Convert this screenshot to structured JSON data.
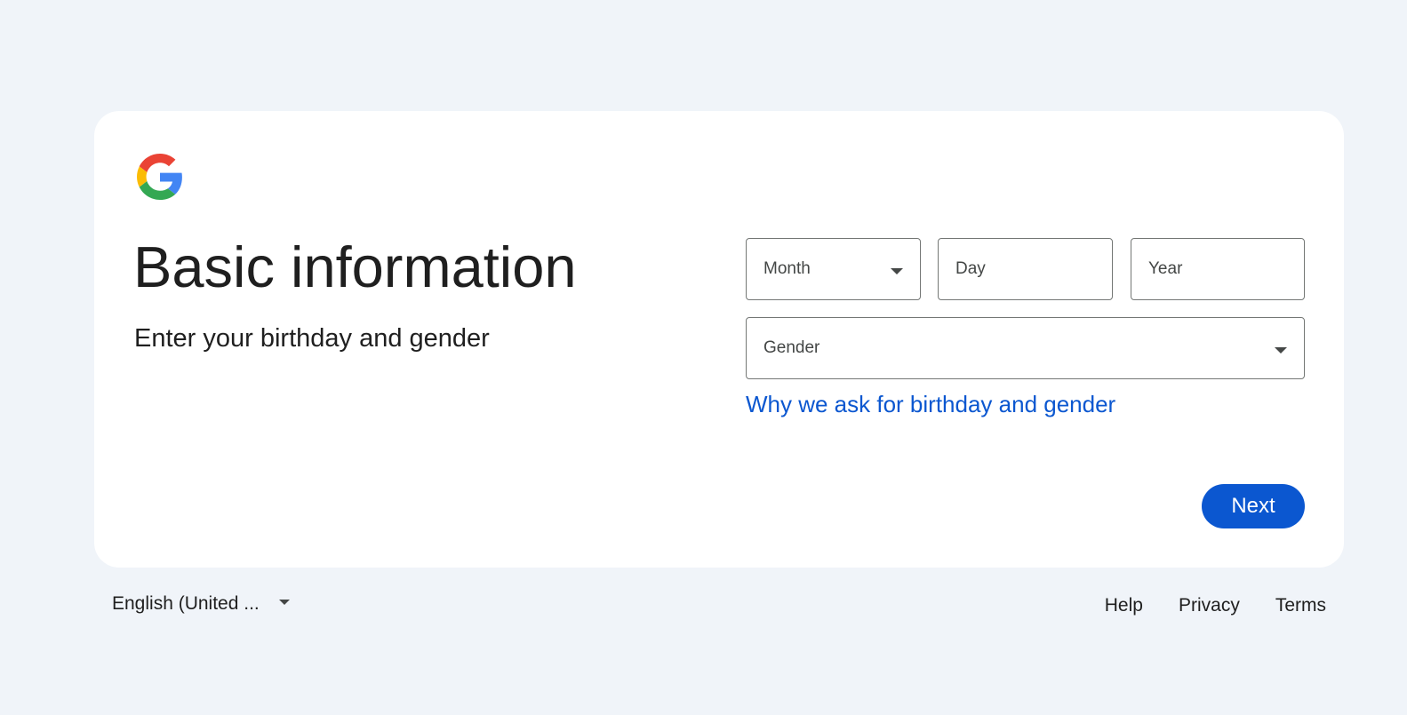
{
  "card": {
    "title": "Basic information",
    "subtitle": "Enter your birthday and gender"
  },
  "form": {
    "month_label": "Month",
    "day_label": "Day",
    "year_label": "Year",
    "gender_label": "Gender",
    "why_link": "Why we ask for birthday and gender",
    "next_label": "Next"
  },
  "footer": {
    "language": "English (United ...",
    "links": [
      "Help",
      "Privacy",
      "Terms"
    ]
  },
  "colors": {
    "page_bg": "#f0f4f9",
    "card_bg": "#ffffff",
    "accent": "#0b57d0",
    "text": "#1f1f1f",
    "border": "#747775"
  },
  "icons": {
    "logo": "google-g-logo",
    "dropdown": "caret-down-icon"
  }
}
